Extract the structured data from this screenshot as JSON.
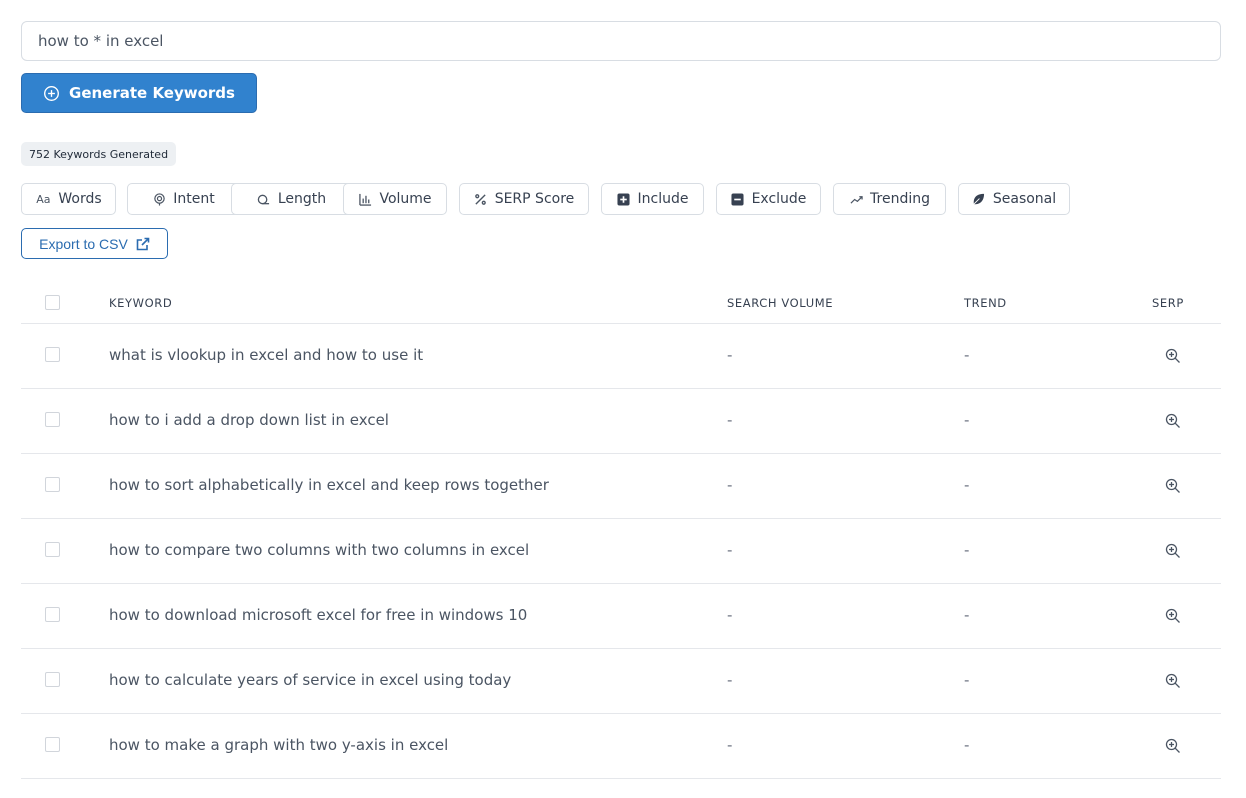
{
  "search": {
    "value": "how to * in excel"
  },
  "generate_button": {
    "label": "Generate Keywords",
    "color": "#3182ce"
  },
  "keyword_count": "752 Keywords Generated",
  "filters": [
    {
      "label": "Words",
      "icon": "text-aa-icon"
    },
    {
      "label": "Intent",
      "icon": "target-icon"
    },
    {
      "label": "Length",
      "icon": "ruler-icon"
    },
    {
      "label": "Volume",
      "icon": "bar-chart-icon"
    },
    {
      "label": "SERP Score",
      "icon": "percent-icon"
    },
    {
      "label": "Include",
      "icon": "plus-square-icon"
    },
    {
      "label": "Exclude",
      "icon": "minus-square-icon"
    },
    {
      "label": "Trending",
      "icon": "trend-up-icon"
    },
    {
      "label": "Seasonal",
      "icon": "leaf-icon"
    }
  ],
  "export_button": {
    "label": "Export to CSV",
    "color": "#2b6cb0"
  },
  "table": {
    "headers": {
      "keyword": "KEYWORD",
      "search_volume": "SEARCH VOLUME",
      "trend": "TREND",
      "serp": "SERP"
    },
    "rows": [
      {
        "keyword": "what is vlookup in excel and how to use it",
        "volume": "-",
        "trend": "-"
      },
      {
        "keyword": "how to i add a drop down list in excel",
        "volume": "-",
        "trend": "-"
      },
      {
        "keyword": "how to sort alphabetically in excel and keep rows together",
        "volume": "-",
        "trend": "-"
      },
      {
        "keyword": "how to compare two columns with two columns in excel",
        "volume": "-",
        "trend": "-"
      },
      {
        "keyword": "how to download microsoft excel for free in windows 10",
        "volume": "-",
        "trend": "-"
      },
      {
        "keyword": "how to calculate years of service in excel using today",
        "volume": "-",
        "trend": "-"
      },
      {
        "keyword": "how to make a graph with two y-axis in excel",
        "volume": "-",
        "trend": "-"
      }
    ]
  }
}
